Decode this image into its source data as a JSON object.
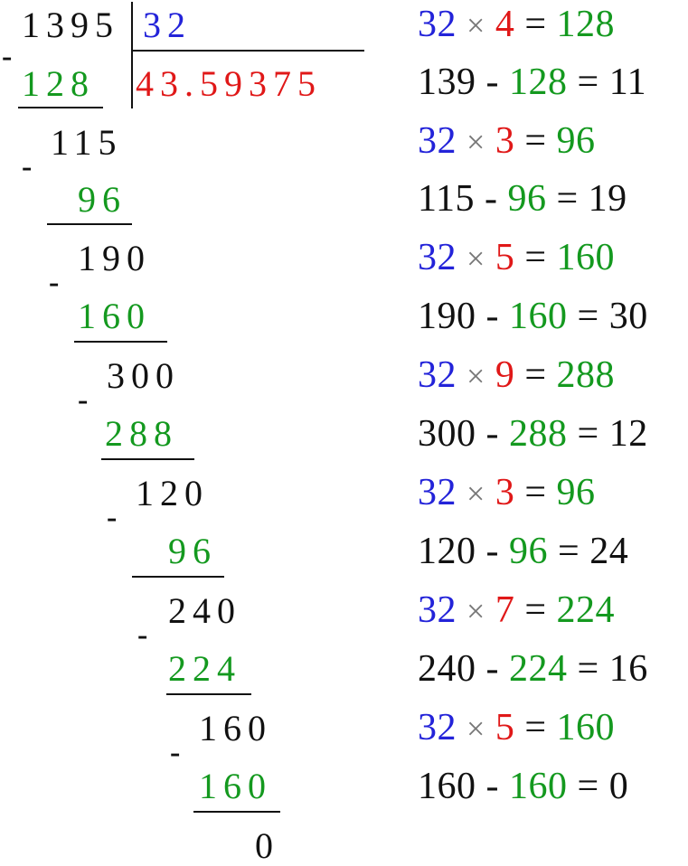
{
  "division": {
    "dividend": "1395",
    "divisor": "32",
    "quotient": "43.59375",
    "steps": [
      {
        "minus": "-",
        "current": "",
        "product": "128"
      },
      {
        "minus": "-",
        "current": "115",
        "product": "96"
      },
      {
        "minus": "-",
        "current": "190",
        "product": "160"
      },
      {
        "minus": "-",
        "current": "300",
        "product": "288"
      },
      {
        "minus": "-",
        "current": "120",
        "product": "96"
      },
      {
        "minus": "-",
        "current": "240",
        "product": "224"
      },
      {
        "minus": "-",
        "current": "160",
        "product": "160"
      }
    ],
    "remainder": "0"
  },
  "calculations": [
    {
      "divisor": "32",
      "times": "×",
      "digit": "4",
      "equals": "=",
      "product": "128",
      "minuend": "139",
      "minus": "-",
      "subtrahend": "128",
      "equals2": "=",
      "difference": "11"
    },
    {
      "divisor": "32",
      "times": "×",
      "digit": "3",
      "equals": "=",
      "product": "96",
      "minuend": "115",
      "minus": "-",
      "subtrahend": "96",
      "equals2": "=",
      "difference": "19"
    },
    {
      "divisor": "32",
      "times": "×",
      "digit": "5",
      "equals": "=",
      "product": "160",
      "minuend": "190",
      "minus": "-",
      "subtrahend": "160",
      "equals2": "=",
      "difference": "30"
    },
    {
      "divisor": "32",
      "times": "×",
      "digit": "9",
      "equals": "=",
      "product": "288",
      "minuend": "300",
      "minus": "-",
      "subtrahend": "288",
      "equals2": "=",
      "difference": "12"
    },
    {
      "divisor": "32",
      "times": "×",
      "digit": "3",
      "equals": "=",
      "product": "96",
      "minuend": "120",
      "minus": "-",
      "subtrahend": "96",
      "equals2": "=",
      "difference": "24"
    },
    {
      "divisor": "32",
      "times": "×",
      "digit": "7",
      "equals": "=",
      "product": "224",
      "minuend": "240",
      "minus": "-",
      "subtrahend": "224",
      "equals2": "=",
      "difference": "16"
    },
    {
      "divisor": "32",
      "times": "×",
      "digit": "5",
      "equals": "=",
      "product": "160",
      "minuend": "160",
      "minus": "-",
      "subtrahend": "160",
      "equals2": "=",
      "difference": "0"
    }
  ],
  "colors": {
    "divisor": "#2323d9",
    "quotient_digit": "#e01818",
    "product": "#14991f",
    "text": "#111111"
  }
}
